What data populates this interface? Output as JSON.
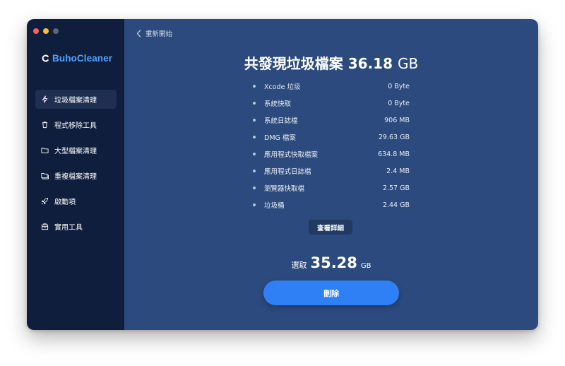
{
  "app": {
    "name": "BuhoCleaner"
  },
  "sidebar": {
    "items": [
      {
        "label": "垃圾檔案清理",
        "icon": "lightning-icon",
        "active": true
      },
      {
        "label": "程式移除工具",
        "icon": "trash-icon",
        "active": false
      },
      {
        "label": "大型檔案清理",
        "icon": "folder-icon",
        "active": false
      },
      {
        "label": "重複檔案清理",
        "icon": "folders-icon",
        "active": false
      },
      {
        "label": "啟動項",
        "icon": "rocket-icon",
        "active": false
      },
      {
        "label": "實用工具",
        "icon": "toolbox-icon",
        "active": false
      }
    ]
  },
  "header": {
    "back_label": "重新開始"
  },
  "summary": {
    "prefix": "共發現垃圾檔案",
    "amount": "36.18",
    "unit": "GB"
  },
  "junk_items": [
    {
      "label": "Xcode 垃圾",
      "size": "0 Byte"
    },
    {
      "label": "系統快取",
      "size": "0 Byte"
    },
    {
      "label": "系統日誌檔",
      "size": "906 MB"
    },
    {
      "label": "DMG 檔案",
      "size": "29.63 GB"
    },
    {
      "label": "應用程式快取檔案",
      "size": "634.8 MB"
    },
    {
      "label": "應用程式日誌檔",
      "size": "2.4 MB"
    },
    {
      "label": "瀏覽器快取檔",
      "size": "2.57 GB"
    },
    {
      "label": "垃圾桶",
      "size": "2.44 GB"
    }
  ],
  "details_button": "查看詳細",
  "selection": {
    "label": "選取",
    "amount": "35.28",
    "unit": "GB"
  },
  "delete_button": "刪除",
  "colors": {
    "sidebar_bg": "#0f1e3d",
    "main_bg": "#2c4a7d",
    "brand": "#4da3ff",
    "primary_button": "#2f80f4"
  }
}
